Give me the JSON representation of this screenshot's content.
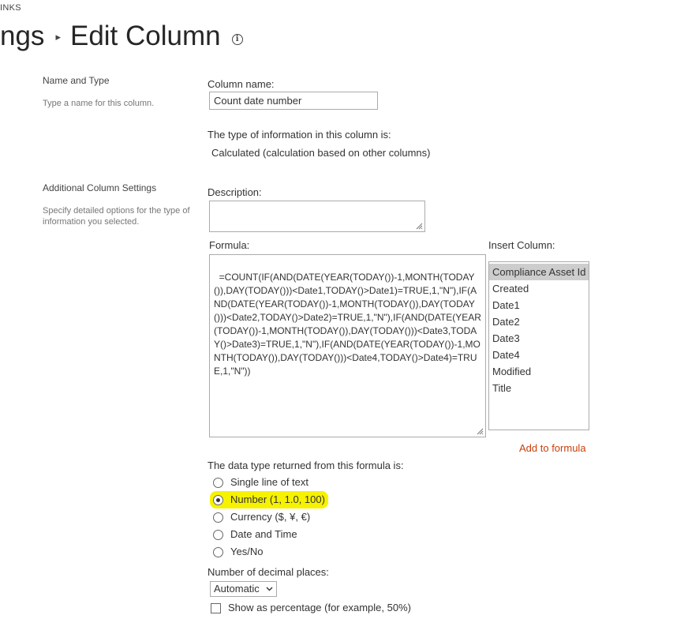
{
  "header": {
    "links_text": "INKS",
    "breadcrumb_prev": "ngs",
    "separator": "▸",
    "page_title": "Edit Column",
    "info_glyph": "i"
  },
  "name_type_section": {
    "title": "Name and Type",
    "description": "Type a name for this column."
  },
  "column_name": {
    "label": "Column name:",
    "value": "Count date number"
  },
  "type_info": {
    "label": "The type of information in this column is:",
    "value": "Calculated (calculation based on other columns)"
  },
  "additional_section": {
    "title": "Additional Column Settings",
    "description": "Specify detailed options for the type of information you selected."
  },
  "description_field": {
    "label": "Description:",
    "value": ""
  },
  "formula": {
    "label": "Formula:",
    "value": "=COUNT(IF(AND(DATE(YEAR(TODAY())-1,MONTH(TODAY()),DAY(TODAY()))<Date1,TODAY()>Date1)=TRUE,1,\"N\"),IF(AND(DATE(YEAR(TODAY())-1,MONTH(TODAY()),DAY(TODAY()))<Date2,TODAY()>Date2)=TRUE,1,\"N\"),IF(AND(DATE(YEAR(TODAY())-1,MONTH(TODAY()),DAY(TODAY()))<Date3,TODAY()>Date3)=TRUE,1,\"N\"),IF(AND(DATE(YEAR(TODAY())-1,MONTH(TODAY()),DAY(TODAY()))<Date4,TODAY()>Date4)=TRUE,1,\"N\"))"
  },
  "insert_column": {
    "label": "Insert Column:",
    "options": [
      "Compliance Asset Id",
      "Created",
      "Date1",
      "Date2",
      "Date3",
      "Date4",
      "Modified",
      "Title"
    ],
    "selected_index": 0,
    "add_link": "Add to formula"
  },
  "data_type": {
    "label": "The data type returned from this formula is:",
    "options": [
      {
        "label": "Single line of text",
        "checked": false
      },
      {
        "label": "Number (1, 1.0, 100)",
        "checked": true
      },
      {
        "label": "Currency ($, ¥, €)",
        "checked": false
      },
      {
        "label": "Date and Time",
        "checked": false
      },
      {
        "label": "Yes/No",
        "checked": false
      }
    ],
    "highlight_color": "#f6f200"
  },
  "decimal_places": {
    "label": "Number of decimal places:",
    "value": "Automatic"
  },
  "percentage": {
    "label": "Show as percentage (for example, 50%)",
    "checked": false
  },
  "colors": {
    "link": "#c8400c",
    "selected_option_bg": "#cdcdcd"
  }
}
